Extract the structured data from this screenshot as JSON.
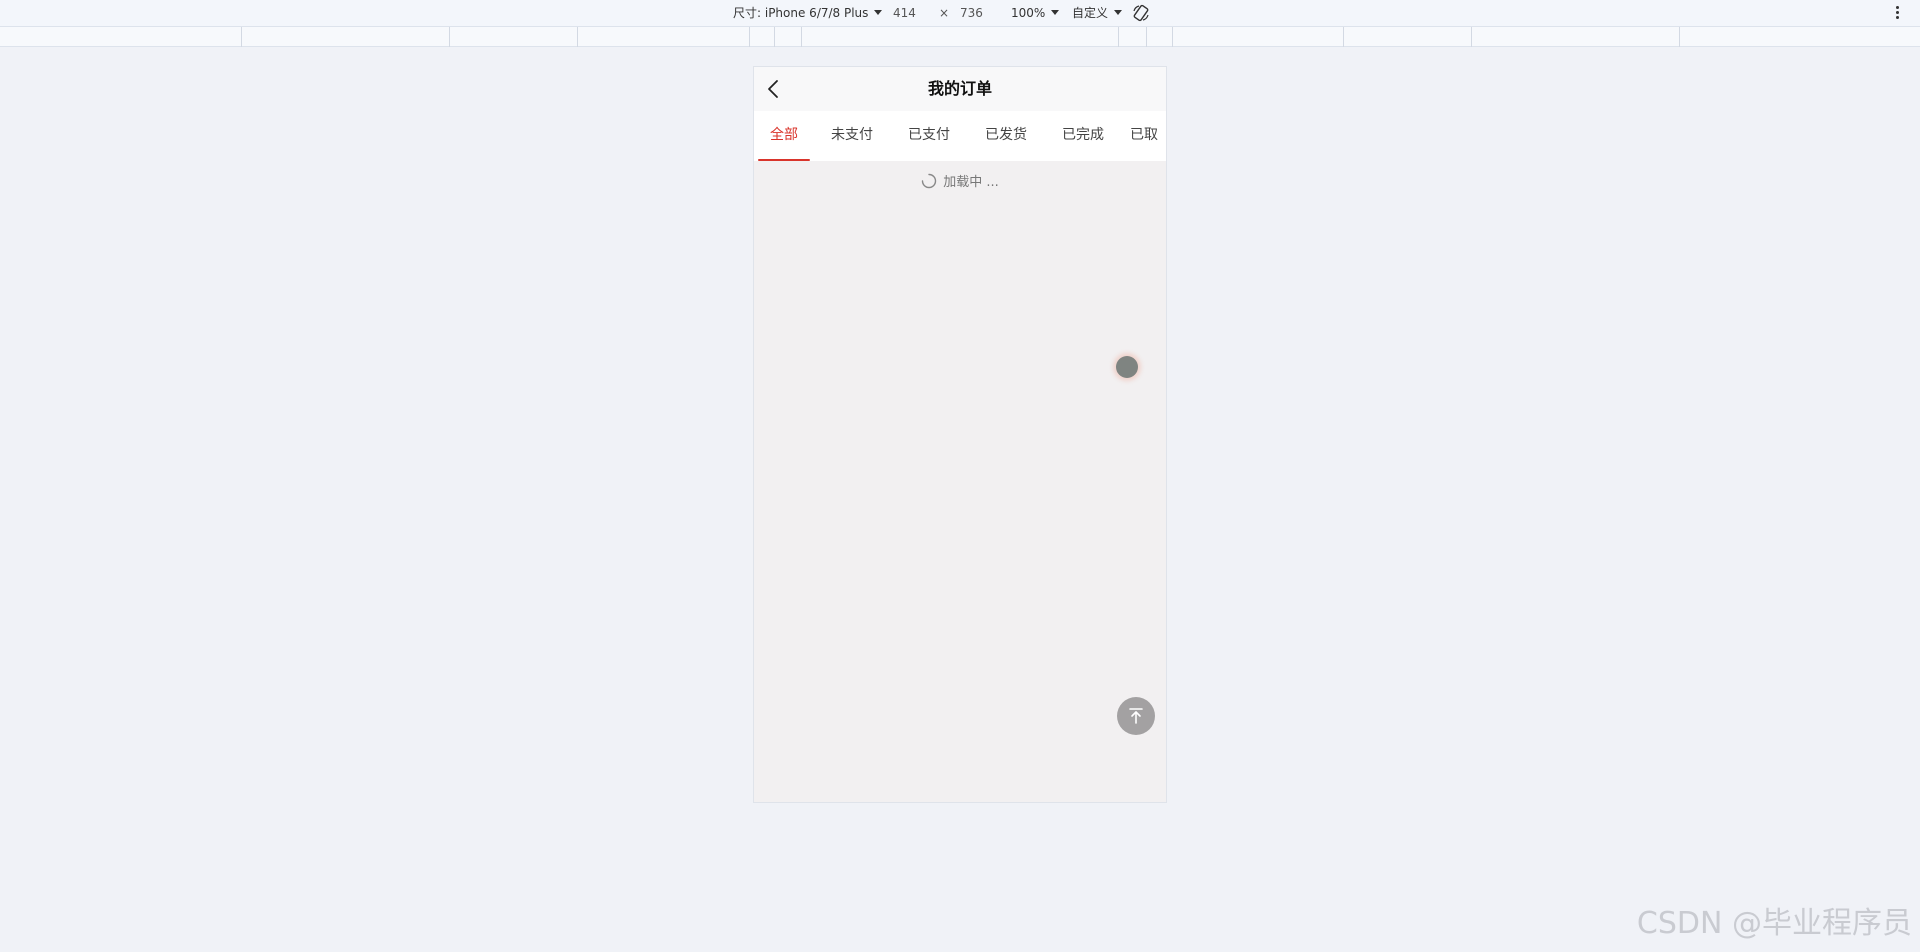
{
  "device_toolbar": {
    "size_label": "尺寸: iPhone 6/7/8 Plus",
    "width_value": "414",
    "times_symbol": "×",
    "height_value": "736",
    "zoom": "100%",
    "throttle": "自定义"
  },
  "app": {
    "nav": {
      "title": "我的订单"
    },
    "tabs": [
      {
        "label": "全部",
        "active": true
      },
      {
        "label": "未支付",
        "active": false
      },
      {
        "label": "已支付",
        "active": false
      },
      {
        "label": "已发货",
        "active": false
      },
      {
        "label": "已完成",
        "active": false
      },
      {
        "label": "已取",
        "active": false
      }
    ],
    "loading_text": "加载中 ..."
  },
  "watermark": "CSDN @毕业程序员",
  "colors": {
    "accent": "#d9342b",
    "page_bg": "#f0f2f7",
    "device_bg": "#f2f0f1"
  },
  "icons": {
    "back": "chevron-left-icon",
    "loading": "spinner-icon",
    "back_to_top": "arrow-up-to-line-icon",
    "rotate": "rotate-device-icon",
    "more": "kebab-menu-icon"
  }
}
